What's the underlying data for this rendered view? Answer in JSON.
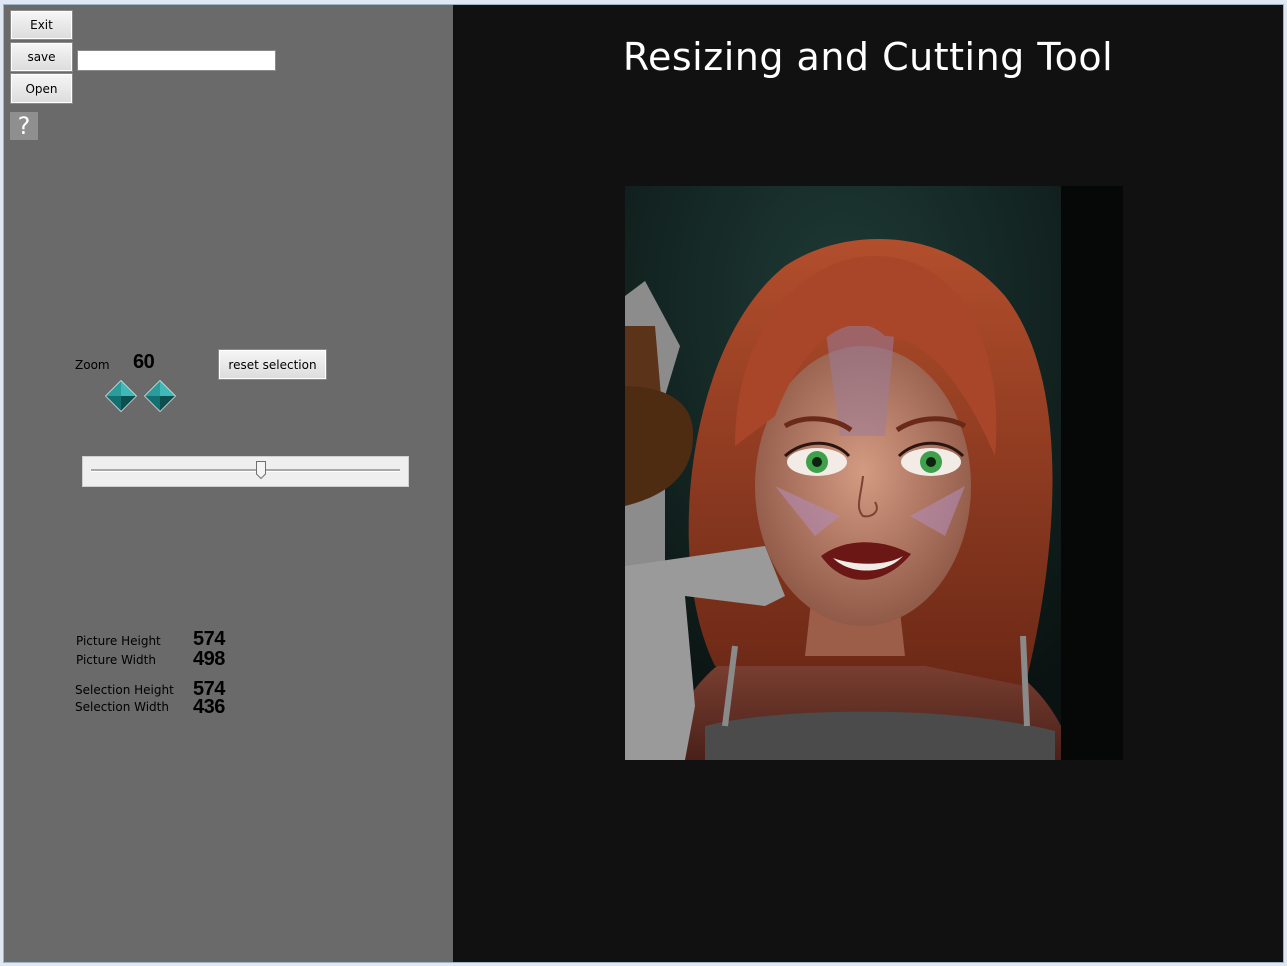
{
  "toolbar": {
    "exit_label": "Exit",
    "save_label": "save",
    "open_label": "Open",
    "filename_value": "",
    "help_label": "?"
  },
  "zoom": {
    "label": "Zoom",
    "value": "60",
    "reset_label": "reset selection",
    "slider_fraction": 0.55
  },
  "stats": {
    "picture_height_label": "Picture Height",
    "picture_height": "574",
    "picture_width_label": "Picture Width",
    "picture_width": "498",
    "selection_height_label": "Selection Height",
    "selection_height": "574",
    "selection_width_label": "Selection Width",
    "selection_width": "436"
  },
  "main": {
    "title": "Resizing and Cutting Tool"
  },
  "colors": {
    "left_panel": "#6a6a6a",
    "right_panel": "#111111",
    "arrow_teal": "#1f8f8f"
  }
}
